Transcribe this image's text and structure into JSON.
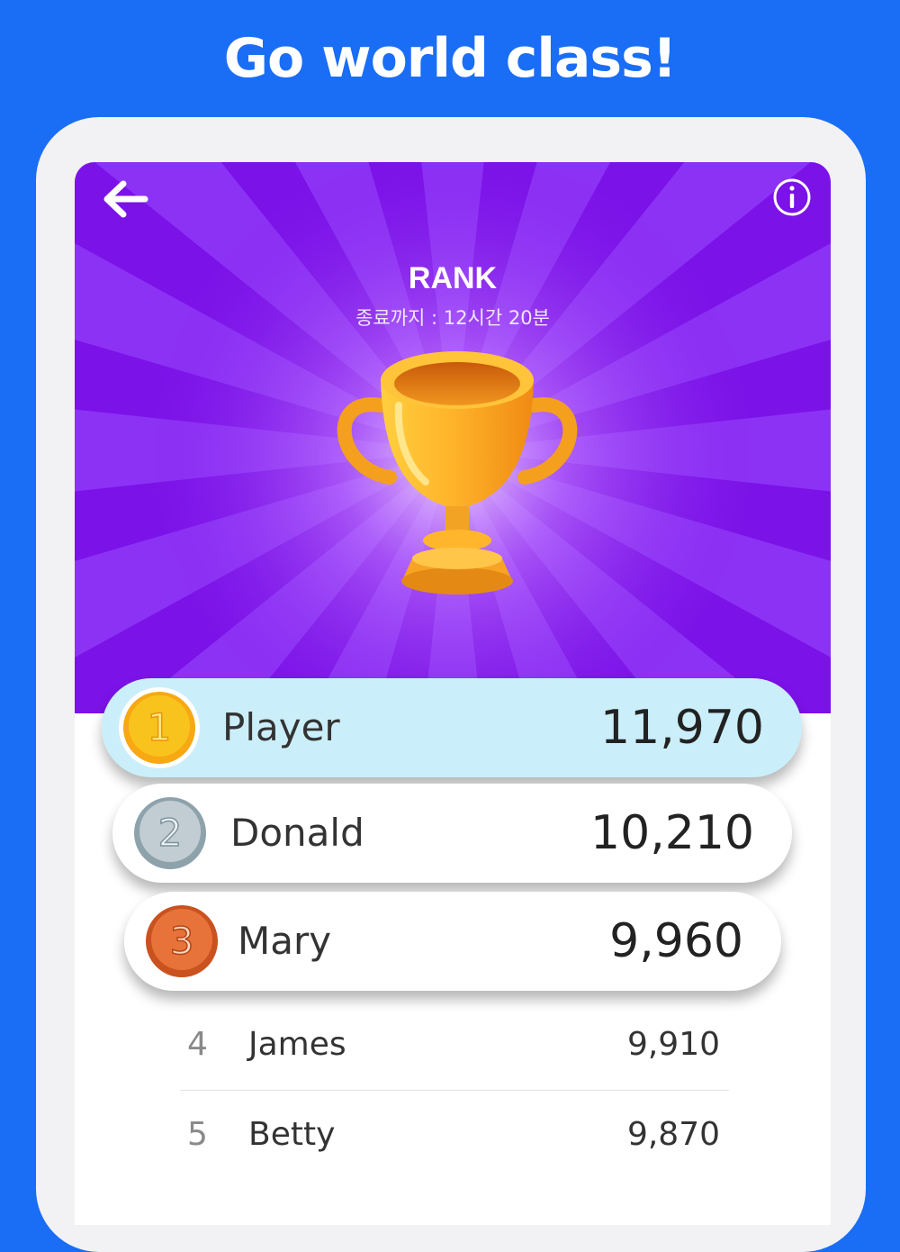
{
  "headline": "Go world class!",
  "header": {
    "back_icon": "arrow-left-icon",
    "info_icon": "info-circle-icon",
    "title": "RANK",
    "subtitle": "종료까지 : 12시간 20분"
  },
  "colors": {
    "background": "#1a6ef5",
    "hero_purple": "#7b12e8",
    "player_highlight": "#cbeffa",
    "gold": "#f7c21a",
    "silver": "#b6c3ca",
    "bronze": "#e06b35"
  },
  "podium": [
    {
      "rank": "1",
      "name": "Player",
      "score": "11,970",
      "medal": "gold-medal-icon"
    },
    {
      "rank": "2",
      "name": "Donald",
      "score": "10,210",
      "medal": "silver-medal-icon"
    },
    {
      "rank": "3",
      "name": "Mary",
      "score": "9,960",
      "medal": "bronze-medal-icon"
    }
  ],
  "list": [
    {
      "rank": "4",
      "name": "James",
      "score": "9,910"
    },
    {
      "rank": "5",
      "name": "Betty",
      "score": "9,870"
    }
  ]
}
